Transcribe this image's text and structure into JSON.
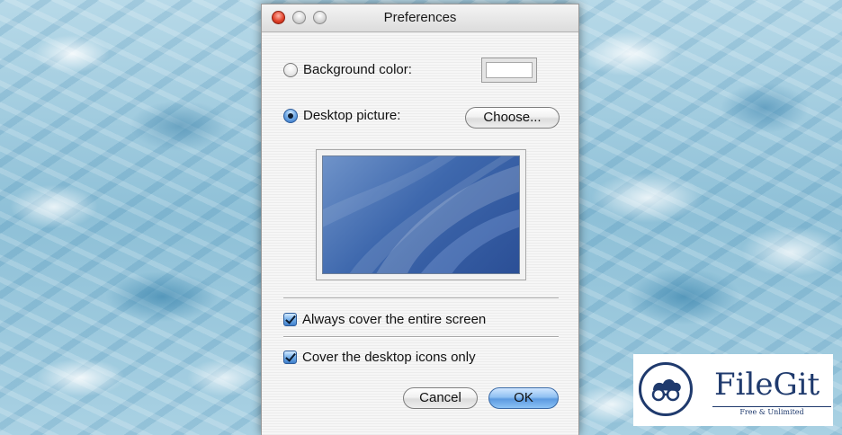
{
  "window": {
    "title": "Preferences"
  },
  "background_option": {
    "label": "Background color:",
    "selected": false,
    "swatch_color": "#ffffff"
  },
  "picture_option": {
    "label": "Desktop picture:",
    "selected": true,
    "choose_label": "Choose..."
  },
  "options": {
    "always_cover_label": "Always cover the entire screen",
    "always_cover_checked": true,
    "icons_only_label": "Cover the desktop icons only",
    "icons_only_checked": true
  },
  "buttons": {
    "cancel_label": "Cancel",
    "ok_label": "OK"
  },
  "watermark": {
    "brand": "FileGit",
    "tagline": "Free & Unlimited"
  },
  "colors": {
    "accent_blue": "#5c9ae0",
    "brand_navy": "#1f3a6d",
    "close_red": "#e2442c"
  }
}
